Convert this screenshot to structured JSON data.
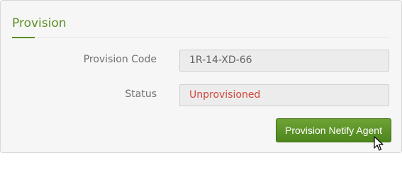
{
  "panel": {
    "title": "Provision"
  },
  "form": {
    "provision_code_label": "Provision Code",
    "provision_code_value": "1R-14-XD-66",
    "status_label": "Status",
    "status_value": "Unprovisioned"
  },
  "actions": {
    "provision_button_label": "Provision Netify Agent"
  },
  "colors": {
    "accent": "#5b8f22",
    "status_unprovisioned": "#d0463a",
    "button": "#5a9128"
  },
  "icons": {
    "cursor": "mouse-pointer-icon"
  }
}
